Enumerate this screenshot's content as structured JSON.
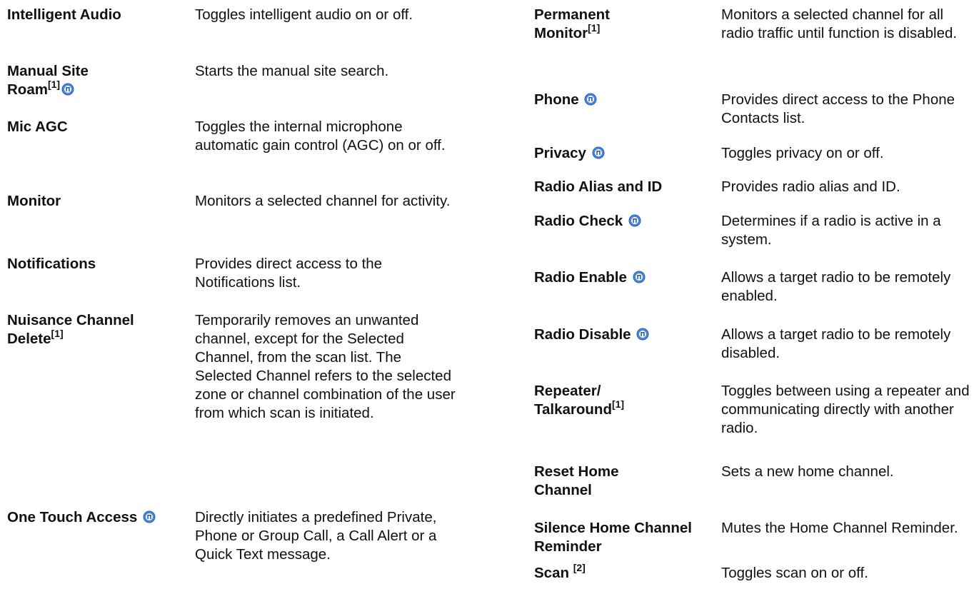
{
  "left_column": [
    {
      "term": "Intelligent Audio",
      "desc": "Toggles intelligent audio on or off."
    },
    {
      "term": "Manual Site Roam",
      "sup": "[1]",
      "icon": "blue-radio-icon",
      "desc": "Starts the manual site search."
    },
    {
      "term": "Mic AGC",
      "desc": "Toggles the internal microphone automatic gain control (AGC) on or off."
    },
    {
      "term": "Monitor",
      "desc": "Monitors a selected channel for activity."
    },
    {
      "term": "Notifications",
      "desc": "Provides direct access to the Notifications list."
    },
    {
      "term": "Nuisance Channel Delete",
      "sup": "[1]",
      "desc": "Temporarily removes an unwanted channel, except for the Selected Channel, from the scan list. The Selected Channel refers to the selected zone or channel combination of the user from which scan is initiated."
    },
    {
      "term": "One Touch Access",
      "icon": "blue-radio-icon",
      "desc": "Directly initiates a predefined Private, Phone or Group Call, a Call Alert or a Quick Text message."
    }
  ],
  "right_column": [
    {
      "term": "Permanent Monitor",
      "sup": "[1]",
      "desc": "Monitors a selected channel for all radio traffic until function is disabled."
    },
    {
      "term": "Phone",
      "icon": "blue-radio-icon",
      "desc": "Provides direct access to the Phone Contacts list."
    },
    {
      "term": "Privacy",
      "icon": "blue-radio-icon",
      "desc": "Toggles privacy on or off."
    },
    {
      "term": "Radio Alias and ID",
      "desc": "Provides radio alias and ID."
    },
    {
      "term": "Radio Check",
      "icon": "blue-radio-icon",
      "desc": "Determines if a radio is active in a system."
    },
    {
      "term": "Radio Enable",
      "icon": "blue-radio-icon",
      "desc": "Allows a target radio to be remotely enabled."
    },
    {
      "term": "Radio Disable",
      "icon": "blue-radio-icon",
      "desc": "Allows a target radio to be remotely disabled."
    },
    {
      "term": "Repeater/ Talkaround",
      "sup": "[1]",
      "desc": "Toggles between using a repeater and communicating directly with another radio."
    },
    {
      "term": "Reset Home Channel",
      "desc": "Sets a new home channel."
    },
    {
      "term": "Silence Home Channel Reminder",
      "desc": "Mutes the Home Channel Reminder."
    },
    {
      "term": "Scan",
      "sup": "[2]",
      "desc": "Toggles scan on or off."
    }
  ]
}
